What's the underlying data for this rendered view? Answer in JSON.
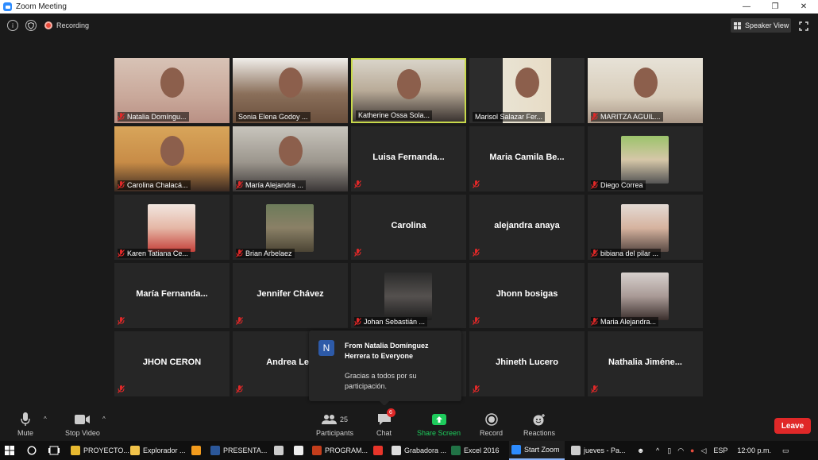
{
  "window": {
    "title": "Zoom Meeting",
    "buttons": [
      "—",
      "❐",
      "✕"
    ]
  },
  "topbar": {
    "recording_label": "Recording",
    "speaker_view_label": "Speaker View",
    "info_icon": "info-icon",
    "shield_icon": "shield-icon"
  },
  "tiles": [
    {
      "name": "Natalia Domíngu...",
      "video": true,
      "muted": true
    },
    {
      "name": "Sonia Elena Godoy ...",
      "video": true,
      "muted": false
    },
    {
      "name": "Katherine Ossa Sola...",
      "video": true,
      "muted": false,
      "active": true
    },
    {
      "name": "Marisol Salazar Fer...",
      "video": true,
      "muted": false
    },
    {
      "name": "MARITZA AGUIL...",
      "video": true,
      "muted": true
    },
    {
      "name": "Carolina Chalacá...",
      "video": true,
      "muted": true
    },
    {
      "name": "María Alejandra ...",
      "video": true,
      "muted": true
    },
    {
      "center_name": "Luisa  Fernanda...",
      "muted": true
    },
    {
      "center_name": "Maria Camila Be...",
      "muted": true
    },
    {
      "name": "Diego Correa",
      "thumb": true,
      "muted": true
    },
    {
      "name": "Karen Tatiana Ce...",
      "thumb": true,
      "muted": true
    },
    {
      "name": "Brian Arbelaez",
      "thumb": true,
      "muted": true
    },
    {
      "center_name": "Carolina",
      "muted": true
    },
    {
      "center_name": "alejandra anaya",
      "muted": true
    },
    {
      "name": "bibiana del pilar ...",
      "thumb": true,
      "muted": true
    },
    {
      "center_name": "María  Fernanda...",
      "muted": true
    },
    {
      "center_name": "Jennifer Chávez",
      "muted": true
    },
    {
      "name": "Johan Sebastián ...",
      "thumb": true,
      "muted": true
    },
    {
      "center_name": "Jhonn bosigas",
      "muted": true
    },
    {
      "name": "Maria  Alejandra...",
      "thumb": true,
      "muted": true
    },
    {
      "center_name": "JHON CERON",
      "muted": true
    },
    {
      "center_name": "Andrea Leu",
      "muted": true
    },
    {
      "center_name": "",
      "muted": false
    },
    {
      "center_name": "Jhineth Lucero",
      "muted": true
    },
    {
      "center_name": "Nathalia  Jiméne...",
      "muted": true
    }
  ],
  "chat_popup": {
    "avatar_letter": "N",
    "from": "From Natalia Domínguez Herrera to Everyone",
    "message": "Gracias a todos por su participación."
  },
  "toolbar": {
    "mute": "Mute",
    "stop_video": "Stop Video",
    "participants": "Participants",
    "participants_count": "25",
    "chat": "Chat",
    "chat_badge": "6",
    "share_screen": "Share Screen",
    "record": "Record",
    "reactions": "Reactions",
    "leave": "Leave"
  },
  "taskbar": {
    "items": [
      {
        "label": "PROYECTO...",
        "color": "#e8b930"
      },
      {
        "label": "Explorador ...",
        "color": "#f2c34a"
      },
      {
        "label": "",
        "color": "#f29b1d"
      },
      {
        "label": "PRESENTA...",
        "color": "#2b579a"
      },
      {
        "label": "",
        "color": "#cccccc"
      },
      {
        "label": "",
        "color": "#eeeeee"
      },
      {
        "label": "PROGRAM...",
        "color": "#c43e1c"
      },
      {
        "label": "",
        "color": "#e8352a"
      },
      {
        "label": "Grabadora ...",
        "color": "#dddddd"
      },
      {
        "label": "Excel 2016",
        "color": "#217346"
      },
      {
        "label": "Start Zoom",
        "color": "#2d8cff"
      },
      {
        "label": "jueves - Pa...",
        "color": "#cccccc"
      }
    ],
    "lang": "ESP",
    "time": "12:00 p.m."
  },
  "colors": {
    "accent": "#2d8cff",
    "leave": "#e02828",
    "active_border": "#c8d94b",
    "share_green": "#1ecb5c"
  }
}
